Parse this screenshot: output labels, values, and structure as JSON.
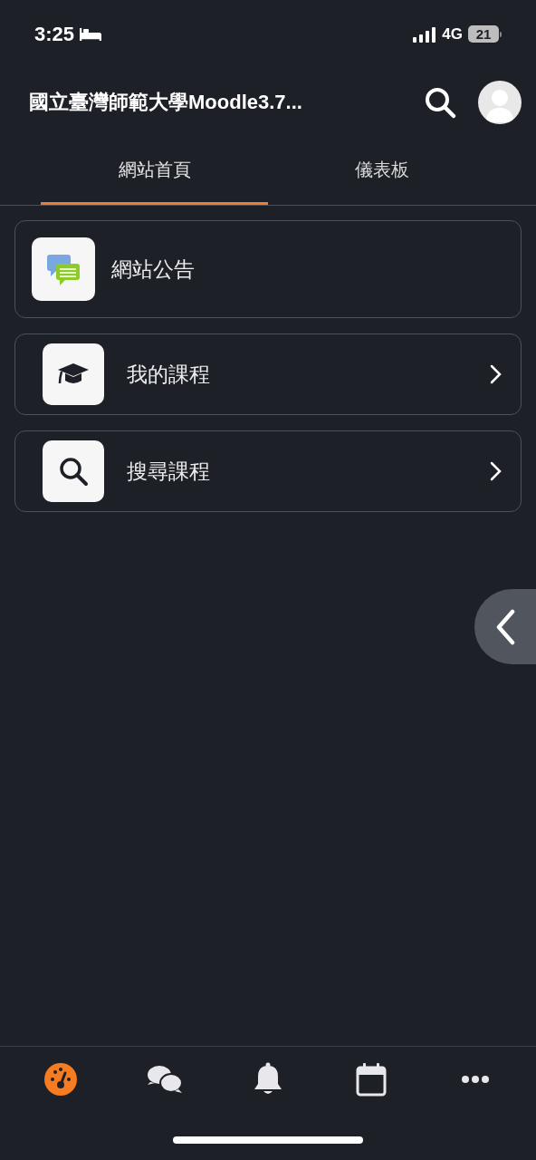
{
  "status_bar": {
    "time": "3:25",
    "network": "4G",
    "battery": "21"
  },
  "header": {
    "title": "國立臺灣師範大學Moodle3.7..."
  },
  "tabs": [
    {
      "label": "網站首頁",
      "selected": true
    },
    {
      "label": "儀表板",
      "selected": false
    }
  ],
  "items": [
    {
      "kind": "forum",
      "label": "網站公告"
    },
    {
      "kind": "courses",
      "label": "我的課程"
    },
    {
      "kind": "search",
      "label": "搜尋課程"
    }
  ],
  "bottom_nav": [
    {
      "kind": "dashboard",
      "selected": true
    },
    {
      "kind": "messages",
      "selected": false
    },
    {
      "kind": "notifications",
      "selected": false
    },
    {
      "kind": "calendar",
      "selected": false
    },
    {
      "kind": "more",
      "selected": false
    }
  ]
}
